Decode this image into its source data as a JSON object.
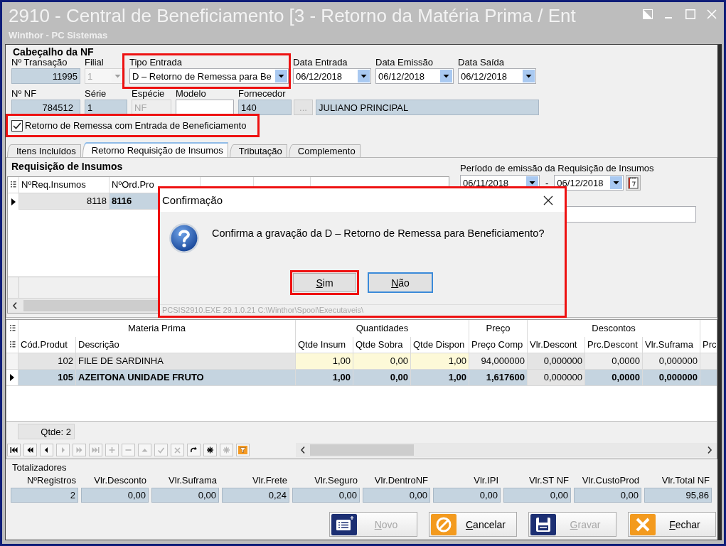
{
  "window": {
    "title": "2910 - Central de Beneficiamento [3 - Retorno da Matéria Prima / Ent",
    "subtitle": "Winthor - PC Sistemas"
  },
  "header": {
    "title": "Cabeçalho da NF",
    "row_1": [
      {
        "label": "Nº Transação",
        "kind": "number",
        "value": "11995",
        "disabled": false,
        "highlighted": false
      },
      {
        "label": "Filial",
        "kind": "combo",
        "value": "1",
        "disabled": true,
        "highlighted": false
      },
      {
        "label": "Tipo Entrada",
        "kind": "combo",
        "value": "D – Retorno de Remessa para Be",
        "disabled": false,
        "highlighted": true
      },
      {
        "label": "Data Entrada",
        "kind": "date",
        "value": "06/12/2018",
        "disabled": false,
        "highlighted": false
      },
      {
        "label": "Data Emissão",
        "kind": "date",
        "value": "06/12/2018",
        "disabled": false,
        "highlighted": false
      },
      {
        "label": "Data Saída",
        "kind": "date",
        "value": "06/12/2018",
        "disabled": false,
        "highlighted": false
      }
    ],
    "row_2": [
      {
        "label": "Nº NF",
        "kind": "number",
        "value": "784512",
        "disabled": false
      },
      {
        "label": "Série",
        "kind": "text",
        "value": "1",
        "disabled": false
      },
      {
        "label": "Espécie",
        "kind": "text",
        "value": "NF",
        "disabled": true
      },
      {
        "label": "Modelo",
        "kind": "input",
        "disabled": false
      },
      {
        "label": "Fornecedor",
        "kind": "lookup",
        "value": "140",
        "button": "...",
        "button_disabled": true,
        "name": "JULIANO PRINCIPAL",
        "disabled": false
      }
    ],
    "checkbox": {
      "label": "Retorno de Remessa com Entrada de Beneficiamento",
      "checked": true,
      "highlighted": true
    }
  },
  "tabs": [
    {
      "label": "Itens Incluídos",
      "selected": false
    },
    {
      "label": "Retorno Requisição de Insumos",
      "selected": true
    },
    {
      "label": "Tributação",
      "selected": false
    },
    {
      "label": "Complemento",
      "selected": false
    }
  ],
  "requisicao": {
    "title": "Requisição de Insumos",
    "columns": [
      "NºReq.Insumos",
      "NºOrd.Pro"
    ],
    "rows": [
      {
        "cells": [
          "8118",
          "8116"
        ],
        "selected": true
      }
    ]
  },
  "periodo": {
    "label": "Período de emissão da Requisição de Insumos",
    "from": "06/11/2018",
    "separator": "-",
    "to": "06/12/2018"
  },
  "dialog": {
    "title": "Confirmação",
    "message": "Confirma a gravação da D – Retorno de Remessa para Beneficiamento?",
    "buttons": [
      {
        "label": "Sim",
        "mnemonic": true,
        "focused": false,
        "highlighted": true
      },
      {
        "label": "Não",
        "mnemonic": true,
        "focused": true,
        "highlighted": false
      }
    ],
    "status": "PCSIS2910.EXE 29.1.0.21 C:\\Winthor\\Spool\\Executaveis\\",
    "highlighted": true
  },
  "items": {
    "groups": [
      {
        "label": "Materia Prima",
        "columns": [
          {
            "label": "Cód.Produt",
            "kind": "code"
          },
          {
            "label": "Descrição",
            "kind": "text"
          }
        ]
      },
      {
        "label": "Quantidades",
        "columns": [
          {
            "label": "Qtde Insum",
            "kind": "qty"
          },
          {
            "label": "Qtde Sobra",
            "kind": "qty"
          },
          {
            "label": "Qtde Dispon",
            "kind": "qty"
          }
        ]
      },
      {
        "label": "Preço",
        "columns": [
          {
            "label": "Preço Comp",
            "kind": "value"
          }
        ]
      },
      {
        "label": "Descontos",
        "columns": [
          {
            "label": "Vlr.Descont",
            "kind": "locked"
          },
          {
            "label": "Prc.Descont",
            "kind": "value"
          },
          {
            "label": "Vlr.Suframa",
            "kind": "value"
          }
        ]
      },
      {
        "columns": [
          {
            "label": "Prc",
            "kind": "value"
          }
        ]
      }
    ],
    "rows": [
      {
        "cells": [
          "102",
          "FILE DE SARDINHA",
          "1,00",
          "0,00",
          "1,00",
          "94,000000",
          "0,000000",
          "0,0000",
          "0,000000"
        ],
        "selected": false
      },
      {
        "cells": [
          "105",
          "AZEITONA UNIDADE FRUTO",
          "1,00",
          "0,00",
          "1,00",
          "1,617600",
          "0,000000",
          "0,0000",
          "0,000000"
        ],
        "selected": true
      }
    ],
    "count": "Qtde: 2"
  },
  "navigator": [
    {
      "kind": "first",
      "disabled": false
    },
    {
      "kind": "prior_page",
      "disabled": false
    },
    {
      "kind": "prior",
      "disabled": false
    },
    {
      "kind": "next",
      "disabled": true
    },
    {
      "kind": "next_page",
      "disabled": true
    },
    {
      "kind": "last",
      "disabled": true
    },
    {
      "kind": "insert",
      "disabled": true
    },
    {
      "kind": "delete",
      "disabled": true
    },
    {
      "kind": "edit",
      "disabled": true
    },
    {
      "kind": "post",
      "disabled": true
    },
    {
      "kind": "cancel",
      "disabled": true
    },
    {
      "kind": "refresh",
      "disabled": false
    },
    {
      "kind": "apply",
      "disabled": false
    },
    {
      "kind": "apply",
      "disabled": true
    },
    {
      "kind": "filter",
      "disabled": false
    }
  ],
  "totals": {
    "title": "Totalizadores",
    "fields": [
      {
        "label": "NºRegistros",
        "value": "2"
      },
      {
        "label": "Vlr.Desconto",
        "value": "0,00"
      },
      {
        "label": "Vlr.Suframa",
        "value": "0,00"
      },
      {
        "label": "Vlr.Frete",
        "value": "0,24"
      },
      {
        "label": "Vlr.Seguro",
        "value": "0,00"
      },
      {
        "label": "Vlr.DentroNF",
        "value": "0,00"
      },
      {
        "label": "Vlr.IPI",
        "value": "0,00"
      },
      {
        "label": "Vlr.ST NF",
        "value": "0,00"
      },
      {
        "label": "Vlr.CustoProd",
        "value": "0,00"
      },
      {
        "label": "Vlr.Total NF",
        "value": "95,86"
      }
    ]
  },
  "actions": [
    {
      "label": "Novo",
      "kind": "new",
      "disabled": true,
      "mnemonic": true
    },
    {
      "label": "Cancelar",
      "kind": "cancel",
      "disabled": false,
      "mnemonic": true
    },
    {
      "label": "Gravar",
      "kind": "save",
      "disabled": true,
      "mnemonic": true
    },
    {
      "label": "Fechar",
      "kind": "close",
      "disabled": false,
      "mnemonic": true
    }
  ]
}
